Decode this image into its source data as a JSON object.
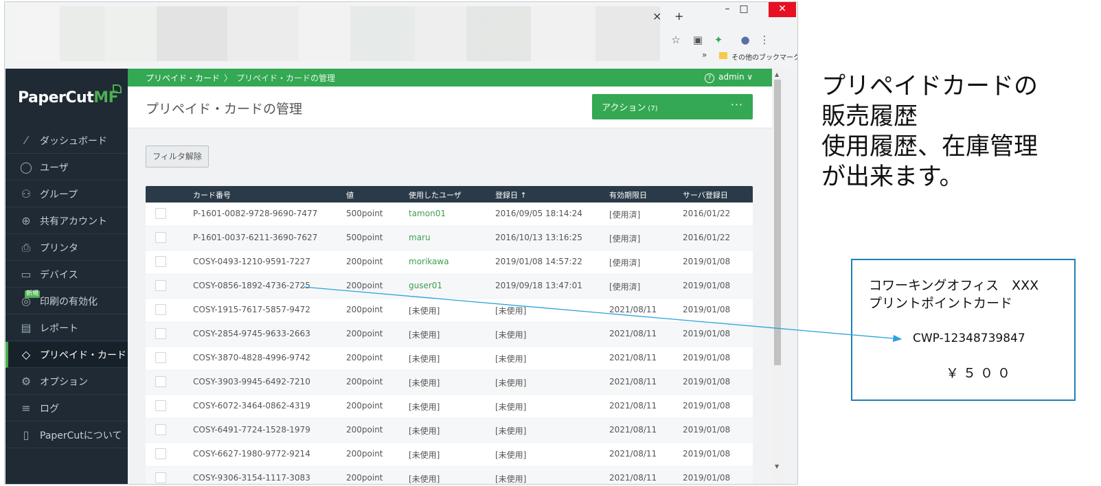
{
  "browser": {
    "close_tab": "×",
    "new_tab": "+",
    "window_controls": {
      "minimize": "–",
      "maximize": "□",
      "close": "✕"
    },
    "bookmarks": {
      "more": "»",
      "other": "その他のブックマーク"
    }
  },
  "app": {
    "logo_text": "PaperCut",
    "logo_suffix": "MF",
    "breadcrumb": [
      "プリペイド・カード",
      "プリペイド・カードの管理"
    ],
    "breadcrumb_sep": "〉",
    "user_menu": "admin ∨",
    "help_icon": "?",
    "page_title": "プリペイド・カードの管理",
    "action_button": {
      "label": "アクション",
      "count": "(7)",
      "more": "···"
    },
    "filter_button": "フィルタ解除",
    "sidebar": {
      "new_badge": "新規",
      "items": [
        {
          "label": "ダッシュボード",
          "icon": "chart-line-icon",
          "glyph": "⁄",
          "active": false
        },
        {
          "label": "ユーザ",
          "icon": "user-icon",
          "glyph": "◯",
          "active": false
        },
        {
          "label": "グループ",
          "icon": "group-icon",
          "glyph": "⚇",
          "active": false
        },
        {
          "label": "共有アカウント",
          "icon": "shared-account-icon",
          "glyph": "⊕",
          "active": false
        },
        {
          "label": "プリンタ",
          "icon": "printer-icon",
          "glyph": "⎙",
          "active": false
        },
        {
          "label": "デバイス",
          "icon": "device-icon",
          "glyph": "▭",
          "active": false
        },
        {
          "label": "印刷の有効化",
          "icon": "print-release-icon",
          "glyph": "◎",
          "active": false
        },
        {
          "label": "レポート",
          "icon": "report-icon",
          "glyph": "▤",
          "active": false
        },
        {
          "label": "プリペイド・カード",
          "icon": "prepaid-card-icon",
          "glyph": "◇",
          "active": true
        },
        {
          "label": "オプション",
          "icon": "gear-icon",
          "glyph": "⚙",
          "active": false
        },
        {
          "label": "ログ",
          "icon": "log-icon",
          "glyph": "≡",
          "active": false
        },
        {
          "label": "PaperCutについて",
          "icon": "about-icon",
          "glyph": "▯",
          "active": false
        }
      ]
    },
    "table": {
      "columns": [
        "カード番号",
        "値",
        "使用したユーザ",
        "登録日 ↑",
        "有効期限日",
        "サーバ登録日"
      ],
      "rows": [
        [
          "P-1601-0082-9728-9690-7477",
          "500point",
          "tamon01",
          "2016/09/05 18:14:24",
          "[使用済]",
          "2016/01/22"
        ],
        [
          "P-1601-0037-6211-3690-7627",
          "500point",
          "maru",
          "2016/10/13 13:16:25",
          "[使用済]",
          "2016/01/22"
        ],
        [
          "COSY-0493-1210-9591-7227",
          "200point",
          "morikawa",
          "2019/01/08 14:57:22",
          "[使用済]",
          "2019/01/08"
        ],
        [
          "COSY-0856-1892-4736-2725",
          "200point",
          "guser01",
          "2019/09/18 13:47:01",
          "[使用済]",
          "2019/01/08"
        ],
        [
          "COSY-1915-7617-5857-9472",
          "200point",
          "[未使用]",
          "[未使用]",
          "2021/08/11",
          "2019/01/08"
        ],
        [
          "COSY-2854-9745-9633-2663",
          "200point",
          "[未使用]",
          "[未使用]",
          "2021/08/11",
          "2019/01/08"
        ],
        [
          "COSY-3870-4828-4996-9742",
          "200point",
          "[未使用]",
          "[未使用]",
          "2021/08/11",
          "2019/01/08"
        ],
        [
          "COSY-3903-9945-6492-7210",
          "200point",
          "[未使用]",
          "[未使用]",
          "2021/08/11",
          "2019/01/08"
        ],
        [
          "COSY-6072-3464-0862-4319",
          "200point",
          "[未使用]",
          "[未使用]",
          "2021/08/11",
          "2019/01/08"
        ],
        [
          "COSY-6491-7724-1528-1979",
          "200point",
          "[未使用]",
          "[未使用]",
          "2021/08/11",
          "2019/01/08"
        ],
        [
          "COSY-6627-1980-9772-9214",
          "200point",
          "[未使用]",
          "[未使用]",
          "2021/08/11",
          "2019/01/08"
        ],
        [
          "COSY-9306-3154-1117-3083",
          "200point",
          "[未使用]",
          "[未使用]",
          "2021/08/11",
          "2019/01/08"
        ]
      ]
    }
  },
  "annotation": {
    "lines": [
      "プリペイドカードの",
      "販売履歴",
      "使用履歴、在庫管理",
      "が出来ます。"
    ]
  },
  "card": {
    "line1": "コワーキングオフィス　XXX",
    "line2": "プリントポイントカード",
    "number": "CWP-12348739847",
    "price": "￥５００"
  },
  "colors": {
    "sidebar": "#1f2a34",
    "accent_green": "#34a853",
    "table_header": "#2b3a48",
    "card_border": "#1f7fb5",
    "arrow": "#29a3dc"
  }
}
